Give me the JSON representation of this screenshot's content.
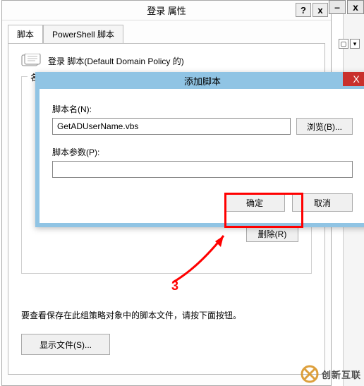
{
  "parent_dialog": {
    "title": "登录 属性",
    "help_btn": "?",
    "close_btn": "x",
    "tabs": {
      "scripts": "脚本",
      "powershell": "PowerShell 脚本"
    },
    "policy_line": "登录 脚本(Default Domain Policy 的)",
    "groupbox_title": "名",
    "buttons": {
      "delete_label": "删除(R)",
      "show_files_label": "显示文件(S)..."
    },
    "hint": "要查看保存在此组策略对象中的脚本文件，请按下面按钮。"
  },
  "add_dialog": {
    "title": "添加脚本",
    "close_btn": "X",
    "script_name_label": "脚本名(N):",
    "script_name_value": "GetADUserName.vbs",
    "browse_label": "浏览(B)...",
    "script_params_label": "脚本参数(P):",
    "script_params_value": "",
    "ok_label": "确定",
    "cancel_label": "取消"
  },
  "annotation": {
    "number": "3"
  },
  "top_right": {
    "min": "–",
    "close": "x"
  },
  "watermark": {
    "text": "创新互联"
  }
}
